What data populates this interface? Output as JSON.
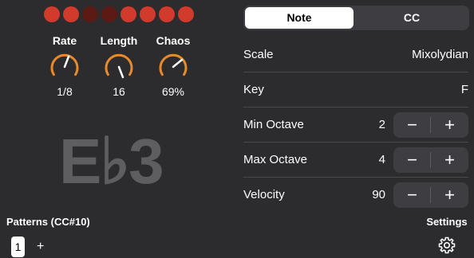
{
  "colors": {
    "led_on": "#d23a2c",
    "led_dim": "#5c1a15",
    "knob_arc": "#e8892b",
    "background": "#2c2c2e"
  },
  "steps": [
    {
      "state": "on"
    },
    {
      "state": "on"
    },
    {
      "state": "dim"
    },
    {
      "state": "dim"
    },
    {
      "state": "on"
    },
    {
      "state": "on"
    },
    {
      "state": "on"
    },
    {
      "state": "on"
    }
  ],
  "knobs": [
    {
      "label": "Rate",
      "value": "1/8"
    },
    {
      "label": "Length",
      "value": "16"
    },
    {
      "label": "Chaos",
      "value": "69%"
    }
  ],
  "note_display": "E♭3",
  "patterns": {
    "label": "Patterns (CC#10)",
    "items": [
      "1"
    ],
    "add_label": "+"
  },
  "settings": {
    "label": "Settings",
    "icon": "gear-icon"
  },
  "mode_tabs": {
    "note": "Note",
    "cc": "CC",
    "selected": "Note"
  },
  "params": {
    "scale": {
      "label": "Scale",
      "value": "Mixolydian"
    },
    "key": {
      "label": "Key",
      "value": "F"
    },
    "min_octave": {
      "label": "Min Octave",
      "value": "2"
    },
    "max_octave": {
      "label": "Max Octave",
      "value": "4"
    },
    "velocity": {
      "label": "Velocity",
      "value": "90"
    }
  },
  "stepper": {
    "minus": "−",
    "plus": "+"
  }
}
